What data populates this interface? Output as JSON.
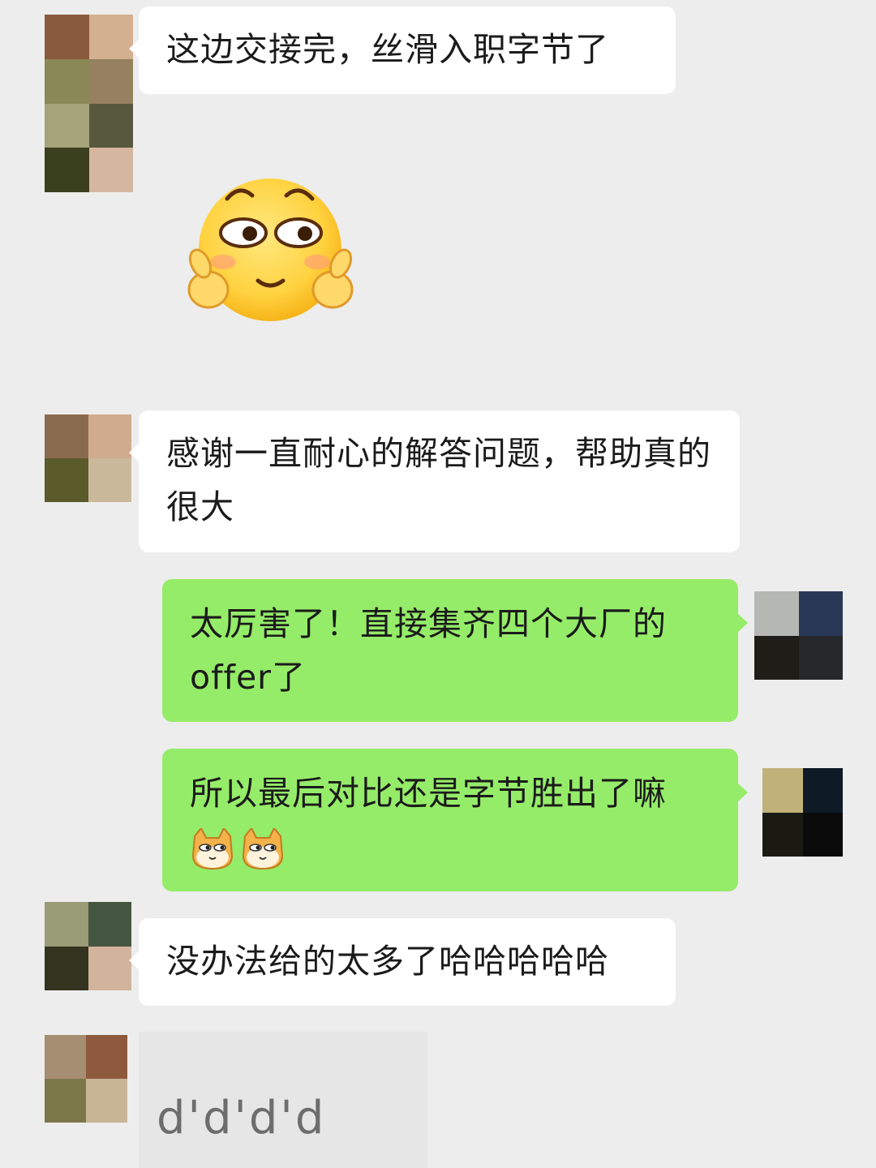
{
  "messages": [
    {
      "side": "left",
      "text": "这边交接完，丝滑入职字节了",
      "avatar_colors": [
        "#8a5a3c",
        "#d3b090",
        "#8a8855",
        "#958060",
        "#a4a37a",
        "#57583d",
        "#3a3f1e",
        "#d5b7a0"
      ]
    },
    {
      "side": "left",
      "sticker": "smiley-finger-heart-icon"
    },
    {
      "side": "left",
      "text": "感谢一直耐心的解答问题，帮助真的很大",
      "avatar_colors": [
        "#8b6b4f",
        "#d0ab8d",
        "#5b5a2a",
        "#c9b89a"
      ]
    },
    {
      "side": "right",
      "text": "太厉害了！直接集齐四个大厂的offer了",
      "avatar_colors": [
        "#b4b7b2",
        "#293857",
        "#201c17",
        "#262829"
      ]
    },
    {
      "side": "right",
      "text": "所以最后对比还是字节胜出了嘛",
      "emoji": [
        "doge-cat-icon",
        "doge-cat-icon"
      ],
      "avatar_colors": [
        "#c0b07a",
        "#0e1a26",
        "#1a1a12",
        "#0b0b0b"
      ]
    },
    {
      "side": "left",
      "text": "没办法给的太多了哈哈哈哈哈",
      "avatar_colors": [
        "#9a9c78",
        "#455640",
        "#323420",
        "#d2b39b"
      ]
    },
    {
      "side": "left",
      "text": "d'd'd'd",
      "avatar_colors": [
        "#a58e72",
        "#8e5a3d",
        "#7b7749",
        "#c8b595"
      ]
    }
  ]
}
